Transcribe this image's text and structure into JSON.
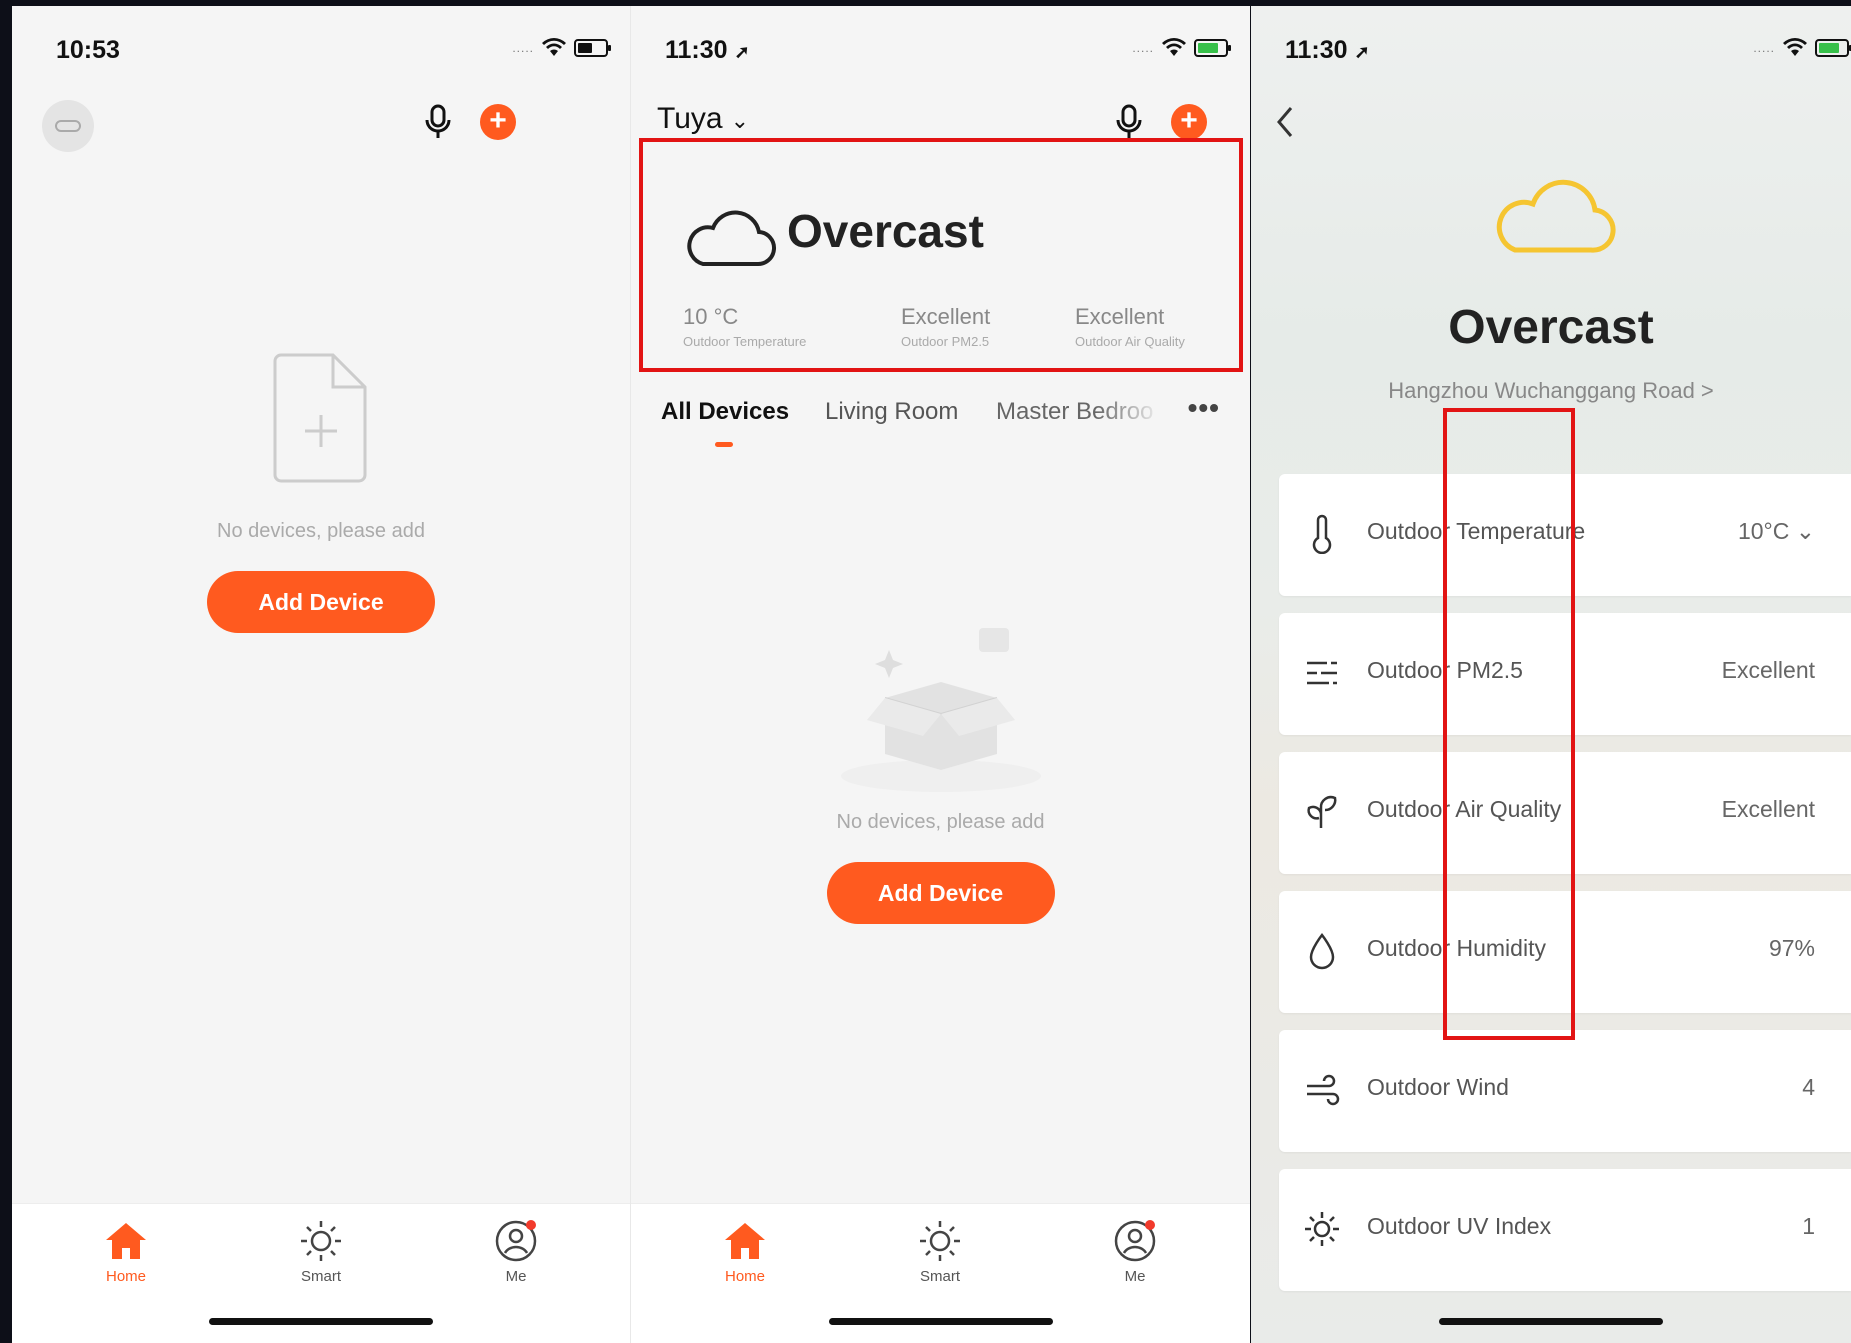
{
  "colors": {
    "accent": "#ff5a1f",
    "highlight": "#e21414"
  },
  "screen1": {
    "time": "10:53",
    "empty_text": "No devices, please add",
    "add_button": "Add Device",
    "tabs": [
      {
        "label": "Home",
        "icon": "home-icon"
      },
      {
        "label": "Smart",
        "icon": "sun-icon"
      },
      {
        "label": "Me",
        "icon": "profile-icon"
      }
    ]
  },
  "screen2": {
    "time": "11:30",
    "home_name": "Tuya",
    "weather": {
      "condition": "Overcast",
      "stats": [
        {
          "value": "10 °C",
          "label": "Outdoor Temperature"
        },
        {
          "value": "Excellent",
          "label": "Outdoor PM2.5"
        },
        {
          "value": "Excellent",
          "label": "Outdoor Air Quality"
        }
      ]
    },
    "rooms": [
      "All Devices",
      "Living Room",
      "Master Bedroo"
    ],
    "more": "•••",
    "empty_text": "No devices, please add",
    "add_button": "Add Device",
    "tabs": [
      {
        "label": "Home",
        "icon": "home-icon"
      },
      {
        "label": "Smart",
        "icon": "sun-icon"
      },
      {
        "label": "Me",
        "icon": "profile-icon"
      }
    ]
  },
  "screen3": {
    "time": "11:30",
    "title": "Overcast",
    "location": "Hangzhou Wuchanggang Road >",
    "rows": [
      {
        "label": "Outdoor Temperature",
        "value": "10°C ⌄",
        "icon": "thermometer-icon"
      },
      {
        "label": "Outdoor PM2.5",
        "value": "Excellent",
        "icon": "pm25-icon"
      },
      {
        "label": "Outdoor Air Quality",
        "value": "Excellent",
        "icon": "leaf-icon"
      },
      {
        "label": "Outdoor Humidity",
        "value": "97%",
        "icon": "droplet-icon"
      },
      {
        "label": "Outdoor Wind",
        "value": "4",
        "icon": "wind-icon"
      },
      {
        "label": "Outdoor UV Index",
        "value": "1",
        "icon": "uv-sun-icon"
      }
    ]
  }
}
